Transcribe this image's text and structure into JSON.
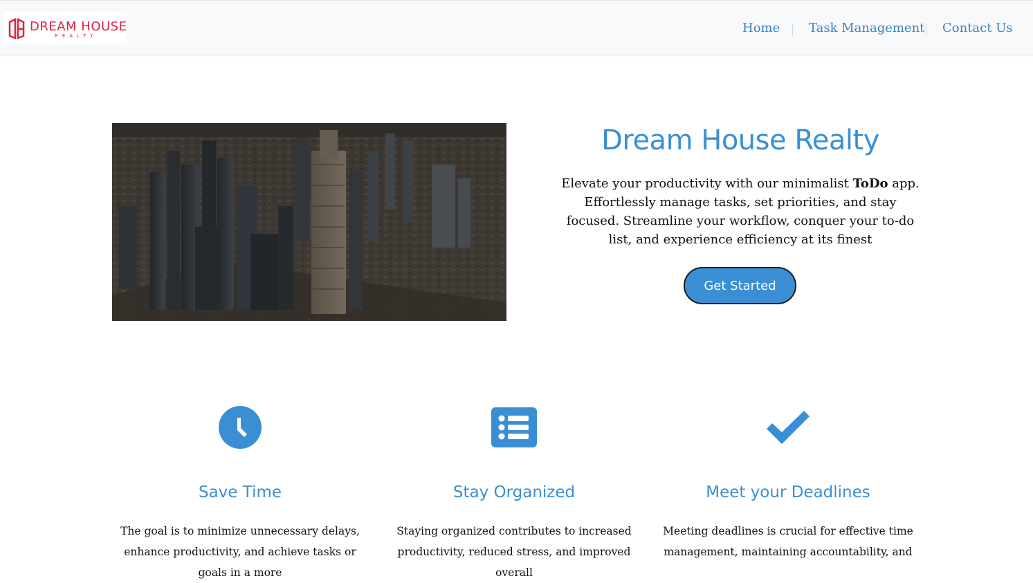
{
  "brand": {
    "name": "DREAM HOUSE",
    "sub": "REALTY",
    "color": "#e0213f"
  },
  "nav": {
    "items": [
      {
        "label": "Home"
      },
      {
        "label": "Task Management"
      },
      {
        "label": "Contact Us"
      }
    ],
    "link_color": "#3b82c4"
  },
  "hero": {
    "image_icon": "city-skyline-image",
    "title": "Dream House Realty",
    "text_before": "Elevate your productivity with our minimalist ",
    "text_bold": "ToDo",
    "text_after": " app. Effortlessly manage tasks, set priorities, and stay focused. Streamline your workflow, conquer your to-do list, and experience efficiency at its finest",
    "cta_label": "Get Started",
    "accent": "#3a8fd4"
  },
  "features": [
    {
      "icon": "clock-icon",
      "title": "Save Time",
      "text": "The goal is to minimize unnecessary delays, enhance productivity, and achieve tasks or goals in a more"
    },
    {
      "icon": "list-icon",
      "title": "Stay Organized",
      "text": "Staying organized contributes to increased productivity, reduced stress, and improved overall"
    },
    {
      "icon": "checkmark-icon",
      "title": "Meet your Deadlines",
      "text": "Meeting deadlines is crucial for effective time management, maintaining accountability, and"
    }
  ]
}
